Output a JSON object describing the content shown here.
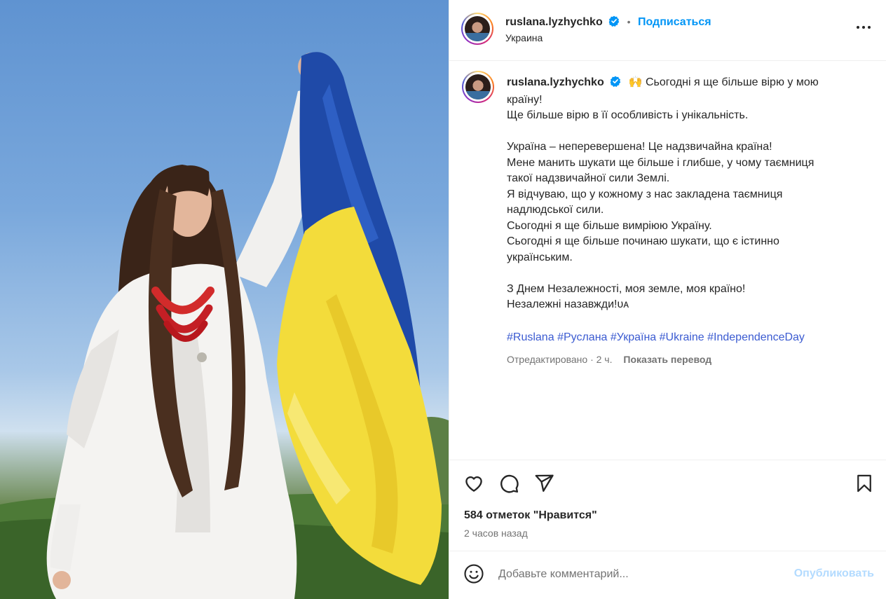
{
  "photo": {
    "alt_icon": "photo-of-woman-holding-ukrainian-flag"
  },
  "header": {
    "username": "ruslana.lyzhychko",
    "separator": "•",
    "follow_label": "Подписаться",
    "location": "Украина",
    "more_icon": "more-dots-icon"
  },
  "caption": {
    "username": "ruslana.lyzhychko",
    "lines": [
      "🙌 Сьогодні я ще більше вірю у мою",
      "країну!",
      "Ще більше вірю в її особливість і унікальність.",
      "",
      "Україна – неперевершена! Це надзвичайна країна!",
      "Мене манить шукати ще більше і глибше, у чому таємниця",
      "такої надзвичайної сили Землі.",
      "Я відчуваю, що у кожному з нас закладена таємниця",
      "надлюдської сили.",
      "Сьогодні я ще більше вимріюю Україну.",
      "Сьогодні я ще більше починаю шукати, що є істинно",
      "українським.",
      "",
      "З Днем Незалежності, моя земле, моя країно!",
      "Незалежні назавжди!ᴜᴀ"
    ],
    "hashtags": [
      "#Ruslana",
      "#Руслана",
      "#Україна",
      "#Ukraine",
      "#IndependenceDay"
    ],
    "meta_text": "Отредактировано · 2 ч.",
    "translate_label": "Показать перевод"
  },
  "actions": {
    "likes_text": "584 отметок \"Нравится\"",
    "time_text": "2 часов назад"
  },
  "comment": {
    "placeholder": "Добавьте комментарий...",
    "publish_label": "Опубликовать"
  },
  "colors": {
    "link": "#0095f6",
    "hashtag": "#3b5bd1",
    "verified": "#0095f6",
    "publish_disabled": "#b3dbff"
  }
}
